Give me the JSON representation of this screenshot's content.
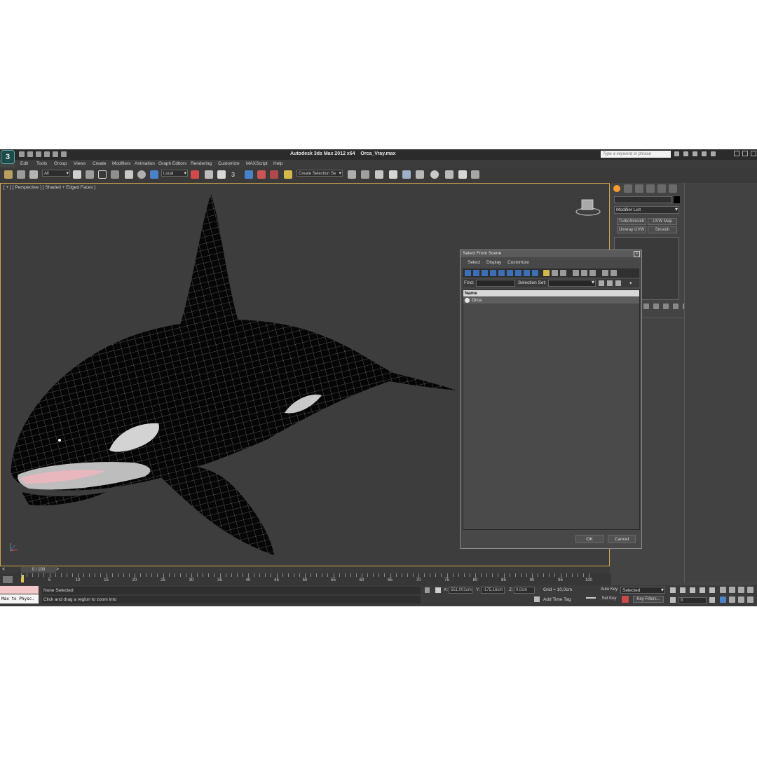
{
  "app": {
    "title_prefix": "Autodesk 3ds Max  2012 x64",
    "file_name": "Orca_Vray.max",
    "search_placeholder": "Type a keyword or phrase",
    "logo_glyph": "3"
  },
  "menu": [
    "Edit",
    "Tools",
    "Group",
    "Views",
    "Create",
    "Modifiers",
    "Animation",
    "Graph Editors",
    "Rendering",
    "Customize",
    "MAXScript",
    "Help"
  ],
  "toolbar": {
    "selection_filter": "All",
    "coordinate_system": "Local",
    "named_selection": "Create Selection Se",
    "snap_label": "3"
  },
  "viewport": {
    "label": "[ + ] [ Perspective ] [ Shaded + Edged Faces ]"
  },
  "command_panel": {
    "modifier_list": "Modifier List",
    "buttons": [
      "TurboSmooth",
      "UVW Map",
      "Unwrap UVW",
      "Smooth"
    ]
  },
  "dialog": {
    "title": "Select From Scene",
    "menu": [
      "Select",
      "Display",
      "Customize"
    ],
    "find_label": "Find:",
    "selection_set_label": "Selection Set:",
    "column_header": "Name",
    "items": [
      "Orca"
    ],
    "ok_label": "OK",
    "cancel_label": "Cancel"
  },
  "timeline": {
    "frame_counter": "0 / 100",
    "ticks": [
      "5",
      "10",
      "15",
      "20",
      "25",
      "30",
      "35",
      "40",
      "45",
      "50",
      "55",
      "60",
      "65",
      "70",
      "75",
      "80",
      "85",
      "90",
      "95",
      "100"
    ]
  },
  "status": {
    "script_listener": "Max to Physc.",
    "selection_info": "None Selected",
    "prompt": "Click and drag a region to zoom into",
    "x_label": "X:",
    "x_value": "551,001cm",
    "y_label": "Y:",
    "y_value": "-175,16cm",
    "z_label": "Z:",
    "z_value": "0,0cm",
    "grid": "Grid = 10,0cm",
    "add_time_tag": "Add Time Tag",
    "auto_key": "Auto Key",
    "set_key": "Set Key",
    "key_mode": "Selected",
    "key_filters": "Key Filters...",
    "current_frame": "0"
  },
  "colors": {
    "viewport_border": "#d0a54a",
    "selection_highlight": "#4a82c8",
    "create_tab": "#ff9b2e"
  }
}
